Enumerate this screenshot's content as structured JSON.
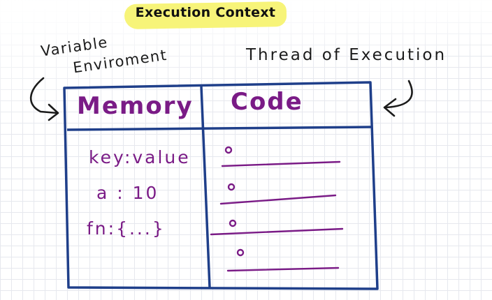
{
  "title": "Execution Context",
  "left_label": [
    "Variable",
    "Enviroment"
  ],
  "right_label": "Thread of Execution",
  "table": {
    "headers": [
      "Memory",
      "Code"
    ],
    "memory_rows": [
      "key:value",
      "a : 10",
      "fn:{...}"
    ],
    "code_line_count": 4
  },
  "colors": {
    "table_border": "#1f3f8a",
    "ink_purple": "#7a1b86",
    "highlight": "#f6f36a"
  }
}
